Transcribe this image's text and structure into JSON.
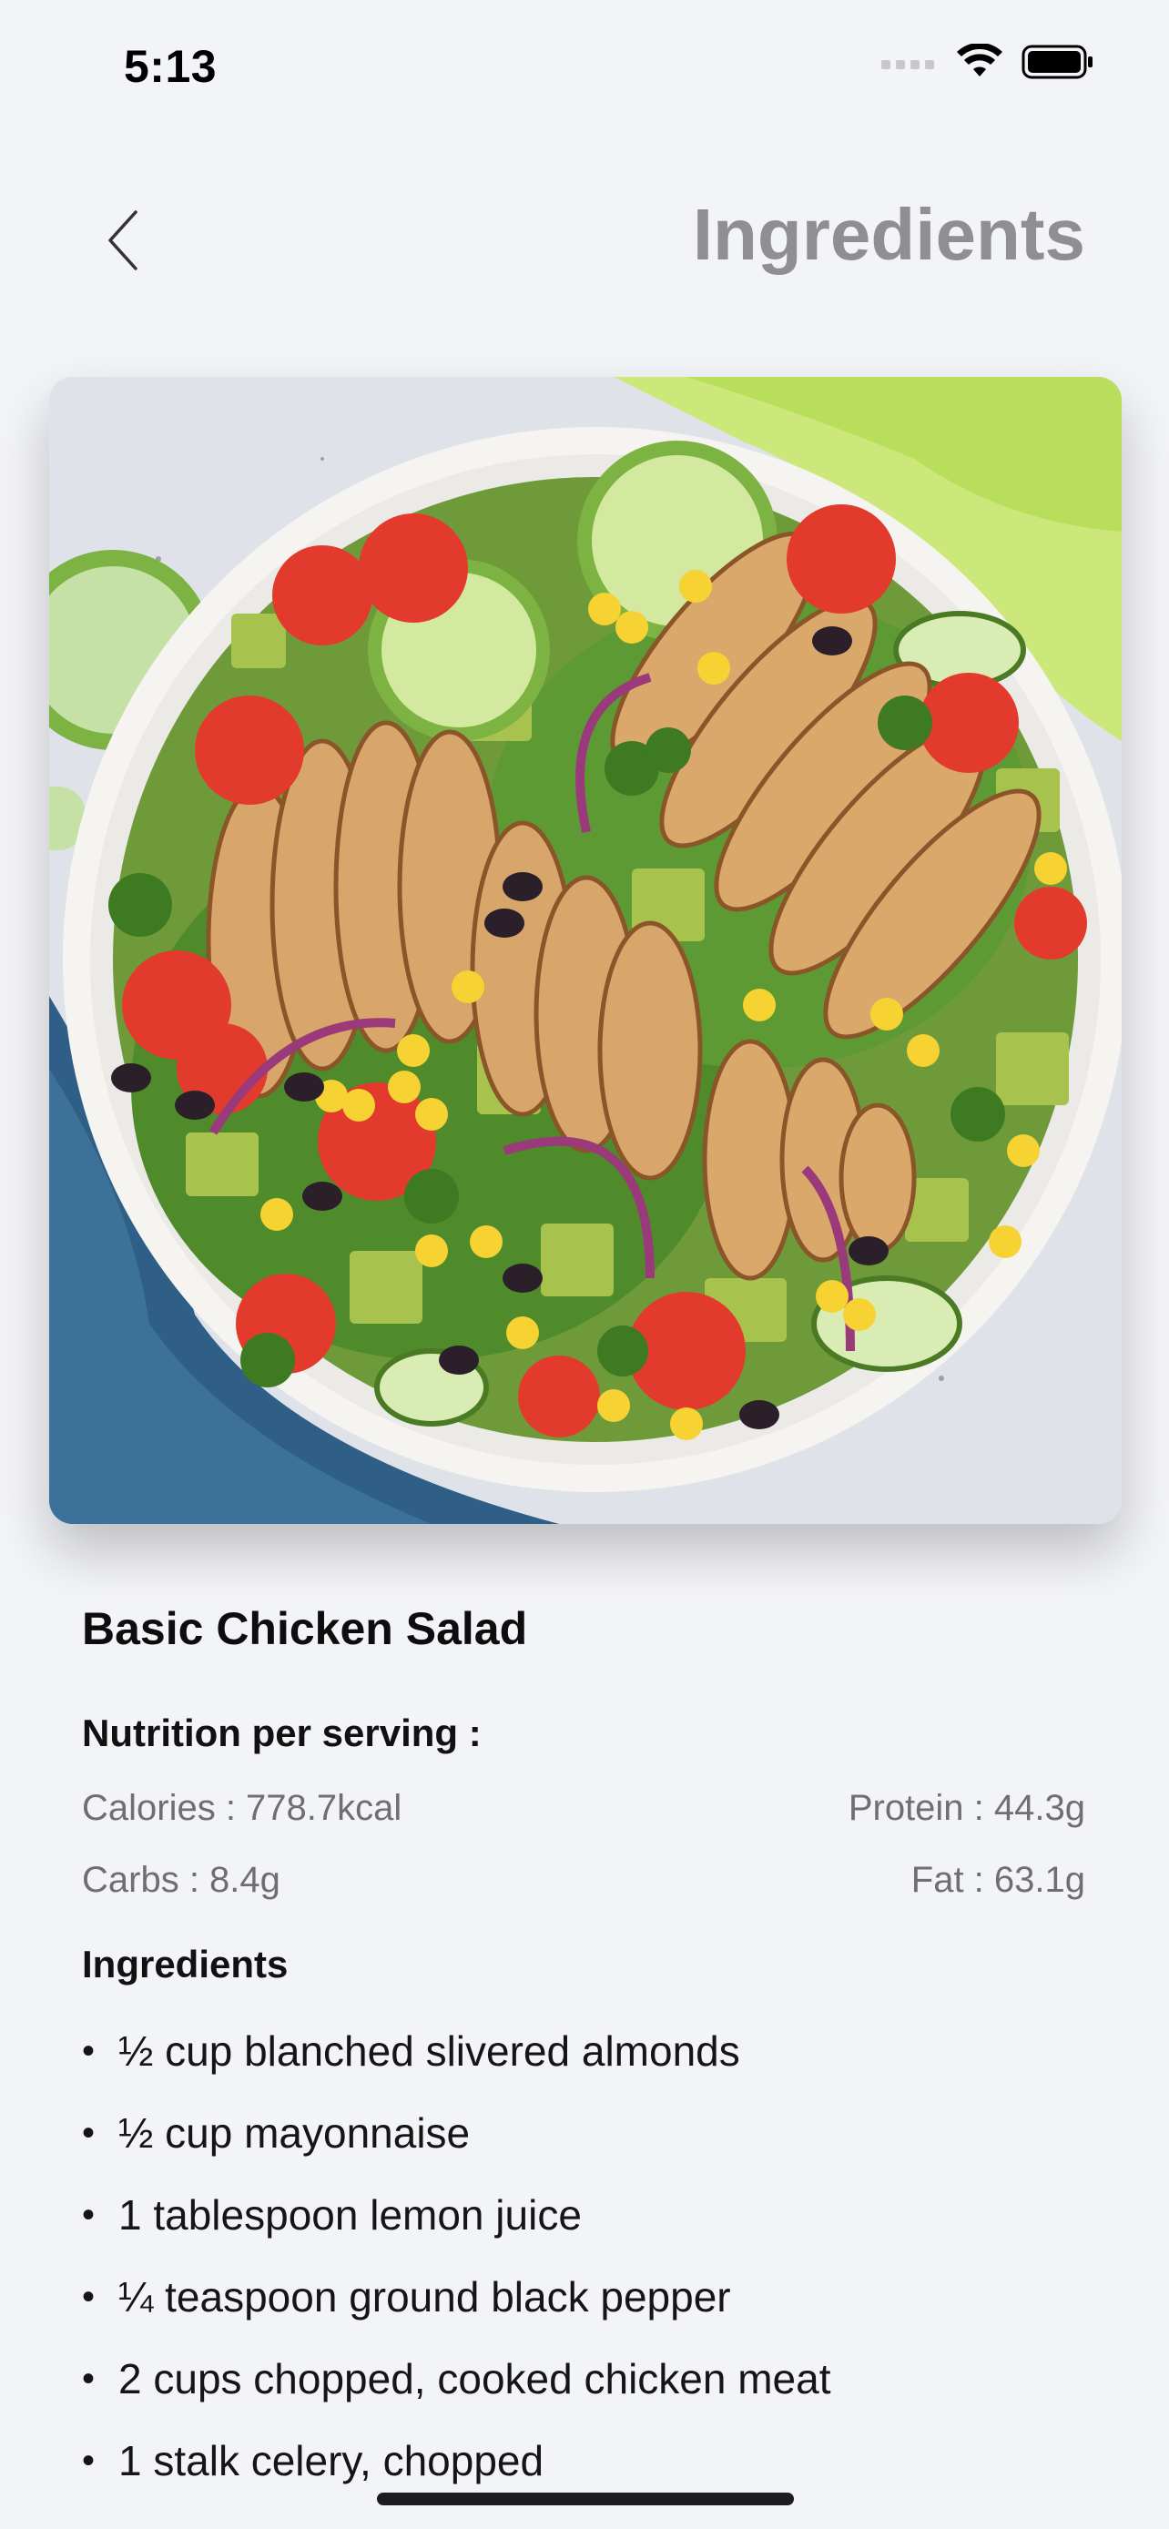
{
  "status_bar": {
    "time": "5:13"
  },
  "header": {
    "title": "Ingredients"
  },
  "recipe": {
    "title": "Basic Chicken Salad",
    "nutrition_heading": "Nutrition per serving :",
    "calories": "Calories : 778.7kcal",
    "protein": "Protein : 44.3g",
    "carbs": "Carbs : 8.4g",
    "fat": "Fat : 63.1g",
    "ingredients_heading": "Ingredients",
    "ingredients": [
      "½ cup blanched slivered almonds",
      "½ cup mayonnaise",
      "1 tablespoon lemon juice",
      "¼ teaspoon ground black pepper",
      "2 cups chopped, cooked chicken meat",
      "1 stalk celery, chopped"
    ]
  },
  "icons": {
    "back": "chevron-left-icon",
    "signal": "signal-icon",
    "wifi": "wifi-icon",
    "battery": "battery-icon"
  }
}
